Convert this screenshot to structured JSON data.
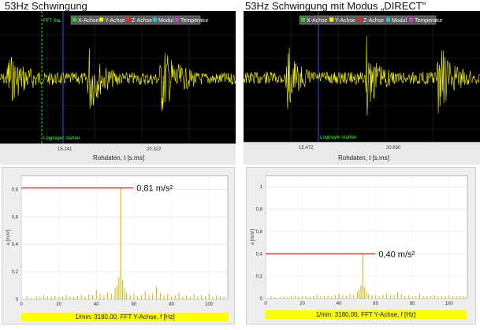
{
  "left": {
    "title": "53Hz Schwingung",
    "legend": [
      {
        "label": "X-Achse",
        "color": "#22dd22"
      },
      {
        "label": "Y-Achse",
        "color": "#ffff00"
      },
      {
        "label": "Z-Achse",
        "color": "#ff2222"
      },
      {
        "label": "Modul",
        "color": "#22cccc"
      },
      {
        "label": "Temperatur",
        "color": "#cc44cc"
      }
    ],
    "fft_start_label": "FFT Sta",
    "logplayer_label": "Logplayer starten",
    "time_ticks": [
      "15.241",
      "20.322"
    ],
    "time_axis_label": "Rohdaten, t [s.ms]",
    "peak_label": "0,81 m/s²",
    "footer": "1/min: 3180.00, FFT Y-Achse, f [Hz]",
    "chart_data": {
      "type": "bar",
      "ylabel": "a [m/s²]",
      "ylim": [
        0,
        0.9
      ],
      "xlim": [
        0,
        110
      ],
      "x_ticks": [
        0,
        20,
        40,
        60,
        80,
        100
      ],
      "y_ticks": [
        0,
        0.2,
        0.4,
        0.6,
        0.8
      ],
      "y_tick_labels": [
        "0",
        "0,2",
        "0,4",
        "0,6",
        "0,8"
      ],
      "peak": {
        "x": 53,
        "y": 0.81
      },
      "x": [
        3,
        5,
        8,
        10,
        12,
        14,
        16,
        18,
        20,
        22,
        24,
        26,
        28,
        30,
        32,
        34,
        36,
        38,
        40,
        42,
        44,
        46,
        48,
        50,
        51,
        52,
        53,
        54,
        55,
        56,
        58,
        60,
        62,
        64,
        66,
        68,
        70,
        72,
        74,
        76,
        78,
        80,
        82,
        84,
        86,
        88,
        90,
        92,
        94,
        96,
        98,
        100,
        102,
        104,
        106,
        108
      ],
      "values": [
        0.02,
        0.01,
        0.02,
        0.015,
        0.03,
        0.02,
        0.02,
        0.025,
        0.015,
        0.02,
        0.03,
        0.02,
        0.02,
        0.025,
        0.03,
        0.02,
        0.035,
        0.03,
        0.07,
        0.04,
        0.03,
        0.05,
        0.04,
        0.08,
        0.1,
        0.16,
        0.81,
        0.14,
        0.08,
        0.05,
        0.03,
        0.04,
        0.02,
        0.03,
        0.06,
        0.03,
        0.04,
        0.09,
        0.05,
        0.03,
        0.04,
        0.02,
        0.03,
        0.05,
        0.02,
        0.03,
        0.02,
        0.04,
        0.02,
        0.03,
        0.02,
        0.04,
        0.02,
        0.03,
        0.02,
        0.02
      ]
    }
  },
  "right": {
    "title": "53Hz Schwingung mit Modus „DIRECT\"",
    "legend": [
      {
        "label": "X-Achse",
        "color": "#22dd22"
      },
      {
        "label": "Y-Achse",
        "color": "#ffff00"
      },
      {
        "label": "Z-Achse",
        "color": "#ff2222"
      },
      {
        "label": "Modul",
        "color": "#22cccc"
      },
      {
        "label": "Temperatur",
        "color": "#cc44cc"
      }
    ],
    "fft_start_label": "",
    "logplayer_label": "Logplayer starten",
    "time_ticks": [
      "15.472",
      "20.630"
    ],
    "time_axis_label": "Rohdaten, t [s.ms]",
    "peak_label": "0,40 m/s²",
    "footer": "1/min: 3180.00, FFT Y-Achse, f [Hz]",
    "chart_data": {
      "type": "bar",
      "ylabel": "a [m/s²]",
      "ylim": [
        0,
        1.1
      ],
      "xlim": [
        0,
        110
      ],
      "x_ticks": [
        0,
        20,
        40,
        60,
        80,
        100
      ],
      "y_ticks": [
        0,
        0.2,
        0.4,
        0.6,
        0.8,
        1.0
      ],
      "y_tick_labels": [
        "0",
        "0,2",
        "0,4",
        "0,6",
        "0,8",
        "1"
      ],
      "peak": {
        "x": 53,
        "y": 0.4
      },
      "x": [
        3,
        5,
        8,
        10,
        12,
        14,
        16,
        18,
        20,
        22,
        24,
        26,
        28,
        30,
        32,
        34,
        36,
        38,
        40,
        42,
        44,
        46,
        48,
        50,
        51,
        52,
        53,
        54,
        55,
        56,
        58,
        60,
        62,
        64,
        66,
        68,
        70,
        72,
        74,
        76,
        78,
        80,
        82,
        84,
        86,
        88,
        90,
        92,
        94,
        96,
        98,
        100,
        102,
        104,
        106,
        108
      ],
      "values": [
        0.02,
        0.01,
        0.015,
        0.02,
        0.015,
        0.02,
        0.025,
        0.015,
        0.02,
        0.02,
        0.015,
        0.02,
        0.03,
        0.02,
        0.02,
        0.025,
        0.02,
        0.03,
        0.04,
        0.03,
        0.02,
        0.04,
        0.03,
        0.06,
        0.08,
        0.12,
        0.4,
        0.1,
        0.06,
        0.04,
        0.03,
        0.03,
        0.02,
        0.03,
        0.04,
        0.03,
        0.03,
        0.06,
        0.04,
        0.02,
        0.03,
        0.02,
        0.02,
        0.04,
        0.02,
        0.02,
        0.02,
        0.03,
        0.02,
        0.02,
        0.02,
        0.03,
        0.02,
        0.02,
        0.02,
        0.02
      ]
    }
  },
  "colors": {
    "plot_bg": "#000000",
    "signal": "#ffff00",
    "peak_line": "#cc1111",
    "fft_bar": "#c8b400",
    "marker_green": "#00ff00",
    "marker_blue": "#3355ff",
    "footer_bg": "#ffff00"
  }
}
